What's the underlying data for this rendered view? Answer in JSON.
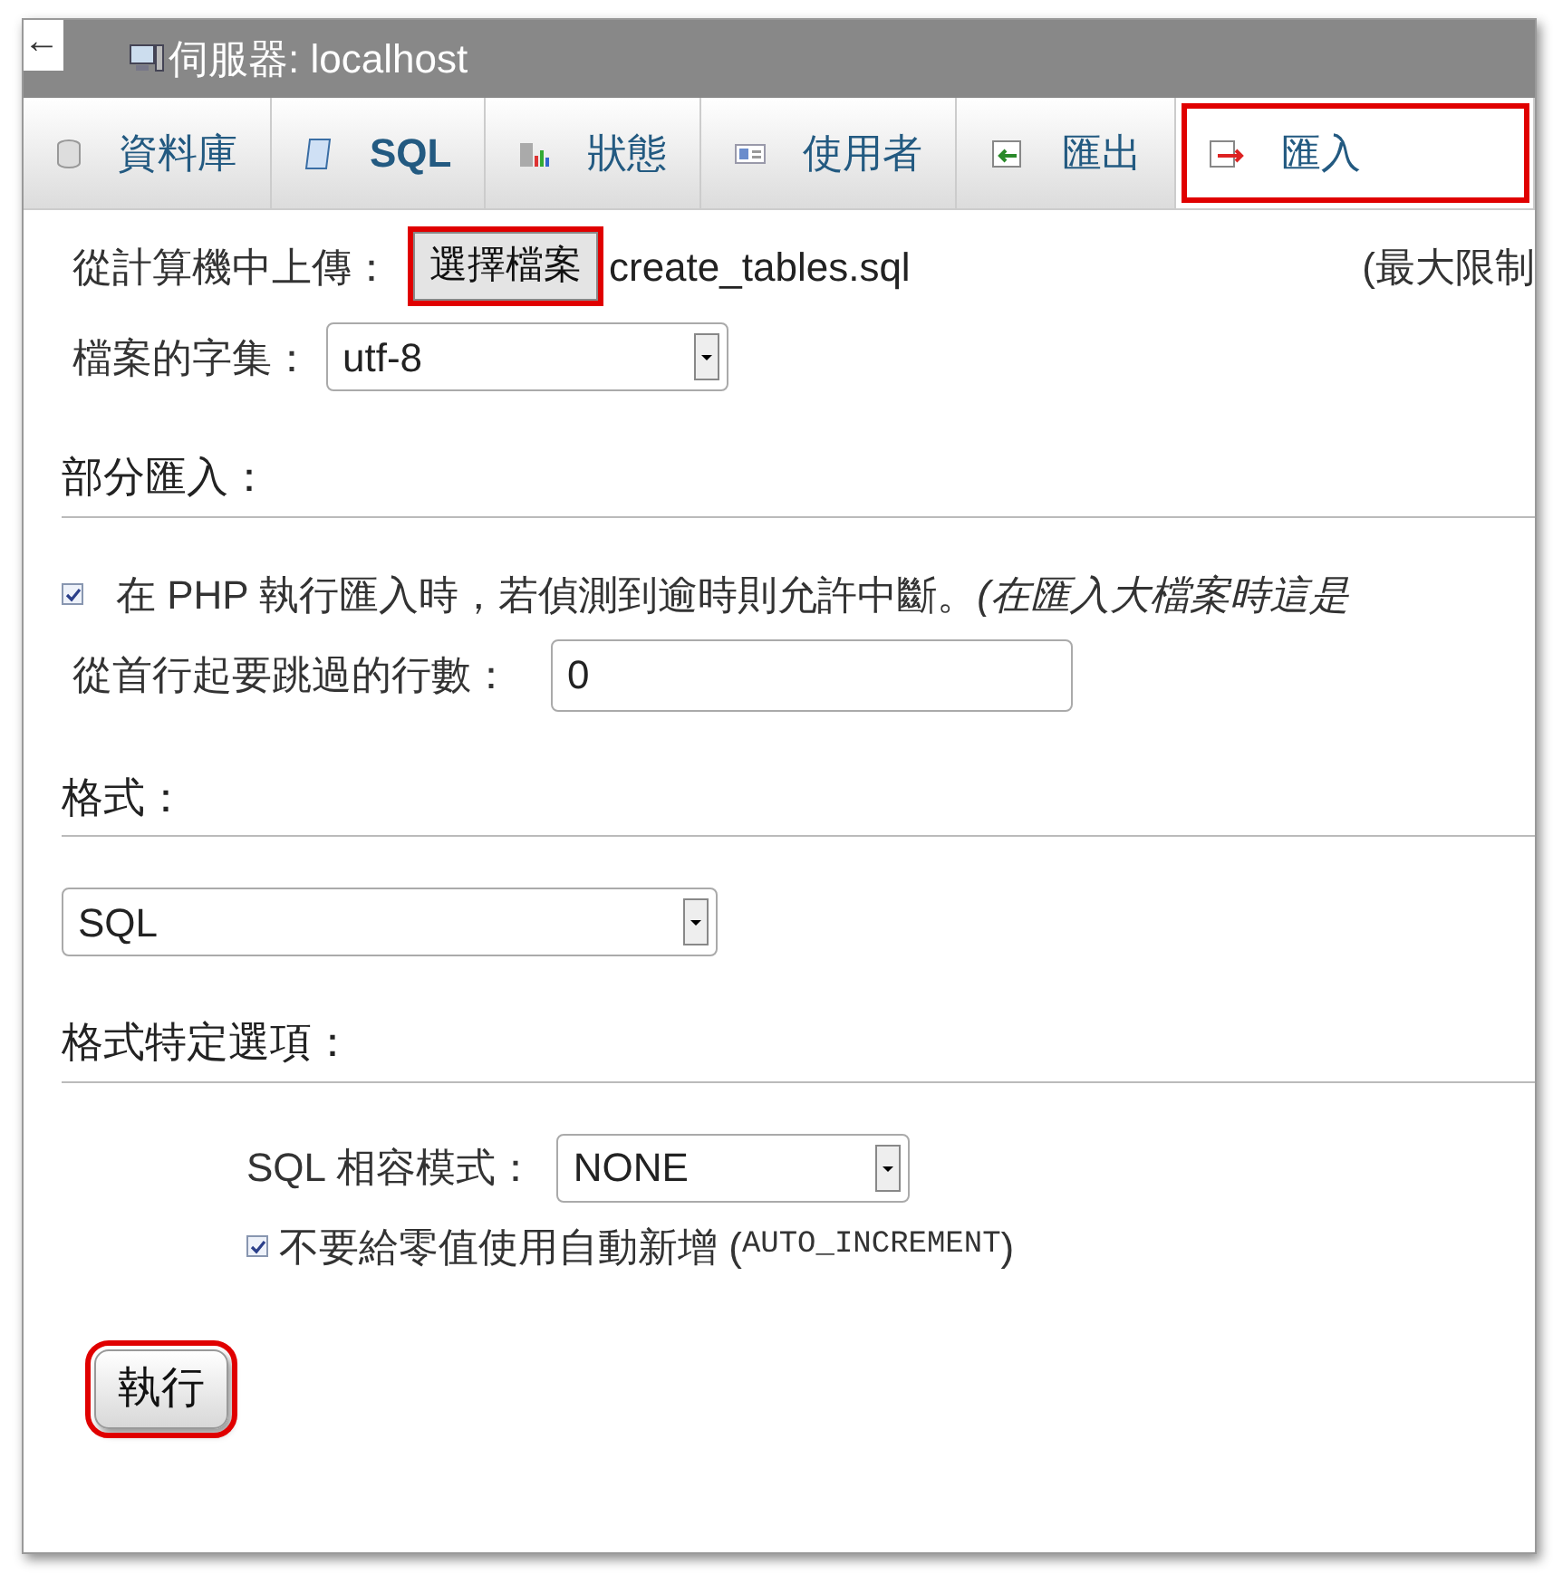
{
  "back_arrow": "←",
  "window": {
    "title": "伺服器: localhost"
  },
  "tabs": [
    {
      "label": "資料庫",
      "kind": "database",
      "selected": false,
      "highlighted": false
    },
    {
      "label": "SQL",
      "kind": "sql",
      "selected": false,
      "highlighted": false
    },
    {
      "label": "狀態",
      "kind": "status",
      "selected": false,
      "highlighted": false
    },
    {
      "label": "使用者",
      "kind": "users",
      "selected": false,
      "highlighted": false
    },
    {
      "label": "匯出",
      "kind": "export",
      "selected": false,
      "highlighted": false
    },
    {
      "label": "匯入",
      "kind": "import",
      "selected": true,
      "highlighted": true
    }
  ],
  "upload": {
    "label": "從計算機中上傳：",
    "button": "選擇檔案",
    "button_highlighted": true,
    "file_name": "create_tables.sql",
    "limit": "(最大限制"
  },
  "charset": {
    "label": "檔案的字集：",
    "value": "utf-8"
  },
  "partial_import": {
    "heading": "部分匯入：",
    "allow_interrupt": {
      "checked": true,
      "label": "在 PHP 執行匯入時，若偵測到逾時則允許中斷。*(在匯入大檔案時這是*"
    },
    "skip_rows": {
      "label": "從首行起要跳過的行數：",
      "value": "0"
    }
  },
  "format": {
    "heading": "格式：",
    "value": "SQL"
  },
  "format_options": {
    "heading": "格式特定選項：",
    "compat": {
      "label": "SQL 相容模式：",
      "value": "NONE"
    },
    "no_auto_value": {
      "checked": true,
      "label": "不要給零值使用自動新增 (",
      "code": "AUTO_INCREMENT",
      "close": ")"
    }
  },
  "go_button": {
    "label": "執行",
    "highlighted": true
  }
}
